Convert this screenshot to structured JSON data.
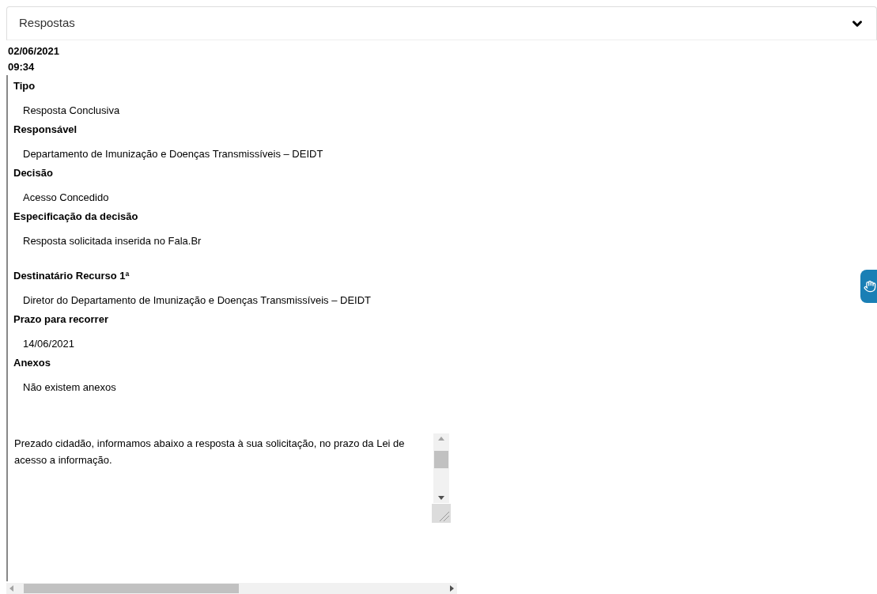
{
  "panel": {
    "title": "Respostas",
    "expanded": true
  },
  "timestamp": {
    "date": "02/06/2021",
    "time": "09:34"
  },
  "fields": [
    {
      "label": "Tipo",
      "value": "Resposta Conclusiva"
    },
    {
      "label": "Responsável",
      "value": "Departamento de Imunização e Doenças Transmissíveis – DEIDT"
    },
    {
      "label": "Decisão",
      "value": "Acesso Concedido"
    },
    {
      "label": "Especificação da decisão",
      "value": "Resposta solicitada inserida no Fala.Br",
      "gap_after": true
    },
    {
      "label": "Destinatário Recurso 1ª",
      "value": "Diretor do Departamento de Imunização e Doenças Transmissíveis – DEIDT"
    },
    {
      "label": "Prazo para recorrer",
      "value": "14/06/2021"
    },
    {
      "label": "Anexos",
      "value": "Não existem anexos"
    }
  ],
  "response_text": "Prezado cidadão, informamos abaixo a resposta à sua solicitação, no prazo da Lei de acesso a informação."
}
